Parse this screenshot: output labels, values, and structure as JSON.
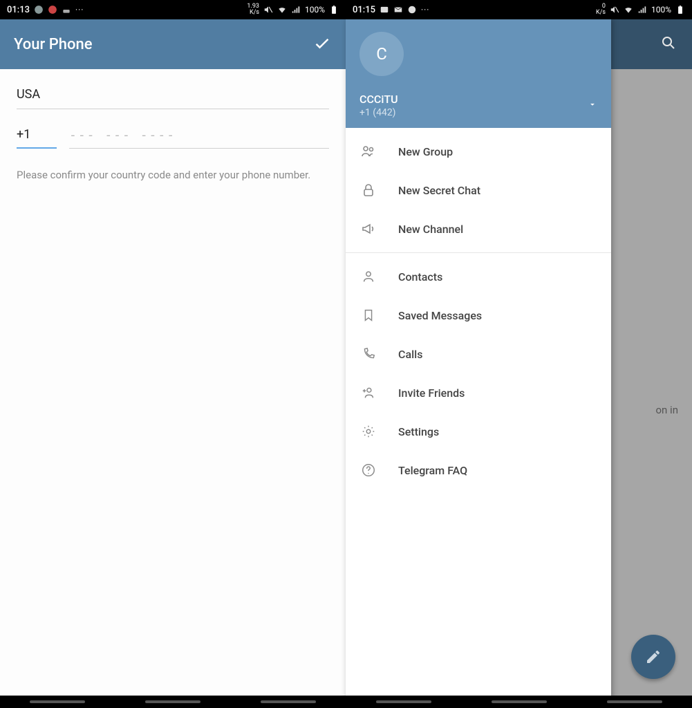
{
  "left": {
    "status": {
      "time": "01:13",
      "speed": "1.93\nK/s",
      "battery": "100%"
    },
    "header": {
      "title": "Your Phone"
    },
    "form": {
      "country": "USA",
      "code": "+1",
      "placeholder": "--- --- ----",
      "hint": "Please confirm your country code and enter your phone number."
    }
  },
  "right": {
    "status": {
      "time": "01:15",
      "speed": "0\nK/s",
      "battery": "100%"
    },
    "background_text": "on in",
    "drawer": {
      "avatar_letter": "C",
      "account_name": "CCCiTU",
      "account_phone": "+1 (442)",
      "menu": {
        "new_group": "New Group",
        "new_secret_chat": "New Secret Chat",
        "new_channel": "New Channel",
        "contacts": "Contacts",
        "saved_messages": "Saved Messages",
        "calls": "Calls",
        "invite_friends": "Invite Friends",
        "settings": "Settings",
        "telegram_faq": "Telegram FAQ"
      }
    }
  }
}
